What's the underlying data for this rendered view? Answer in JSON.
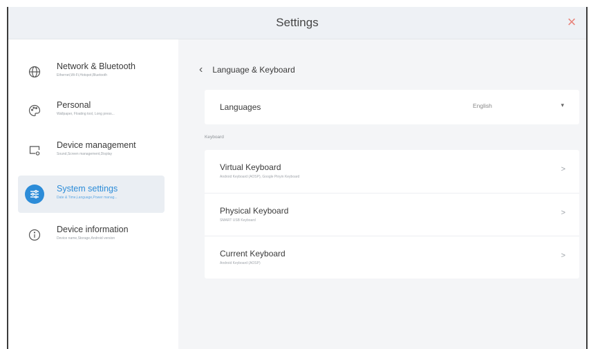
{
  "window": {
    "title": "Settings",
    "close_glyph": "×",
    "close_color": "#e8837a"
  },
  "sidebar": {
    "items": [
      {
        "label": "Network & Bluetooth",
        "subtitle": "Ethernet,Wi-Fi,Hotspot,Bluetooth",
        "icon": "globe-icon",
        "active": false
      },
      {
        "label": "Personal",
        "subtitle": "Wallpaper, Floating tool, Long press...",
        "icon": "palette-icon",
        "active": false
      },
      {
        "label": "Device management",
        "subtitle": "Sound,Screen management,Display",
        "icon": "display-settings-icon",
        "active": false
      },
      {
        "label": "System settings",
        "subtitle": "Date & Time,Language,Power manag...",
        "icon": "sliders-icon",
        "active": true
      },
      {
        "label": "Device information",
        "subtitle": "Device name,Storage,Android version",
        "icon": "info-icon",
        "active": false
      }
    ],
    "accent": "#2c8cd8"
  },
  "main": {
    "breadcrumb": {
      "back_glyph": "‹",
      "title": "Language & Keyboard"
    },
    "languages": {
      "label": "Languages",
      "value": "English",
      "caret": "▾"
    },
    "keyboard_section": {
      "label": "Keyboard",
      "rows": [
        {
          "title": "Virtual Keyboard",
          "subtitle": "Android Keyboard (AOSP), Google Pinyin Keyboard",
          "chevron": ">"
        },
        {
          "title": "Physical Keyboard",
          "subtitle": "SMART USB Keyboard",
          "chevron": ">"
        },
        {
          "title": "Current Keyboard",
          "subtitle": "Android Keyboard (AOSP)",
          "chevron": ">"
        }
      ]
    }
  }
}
